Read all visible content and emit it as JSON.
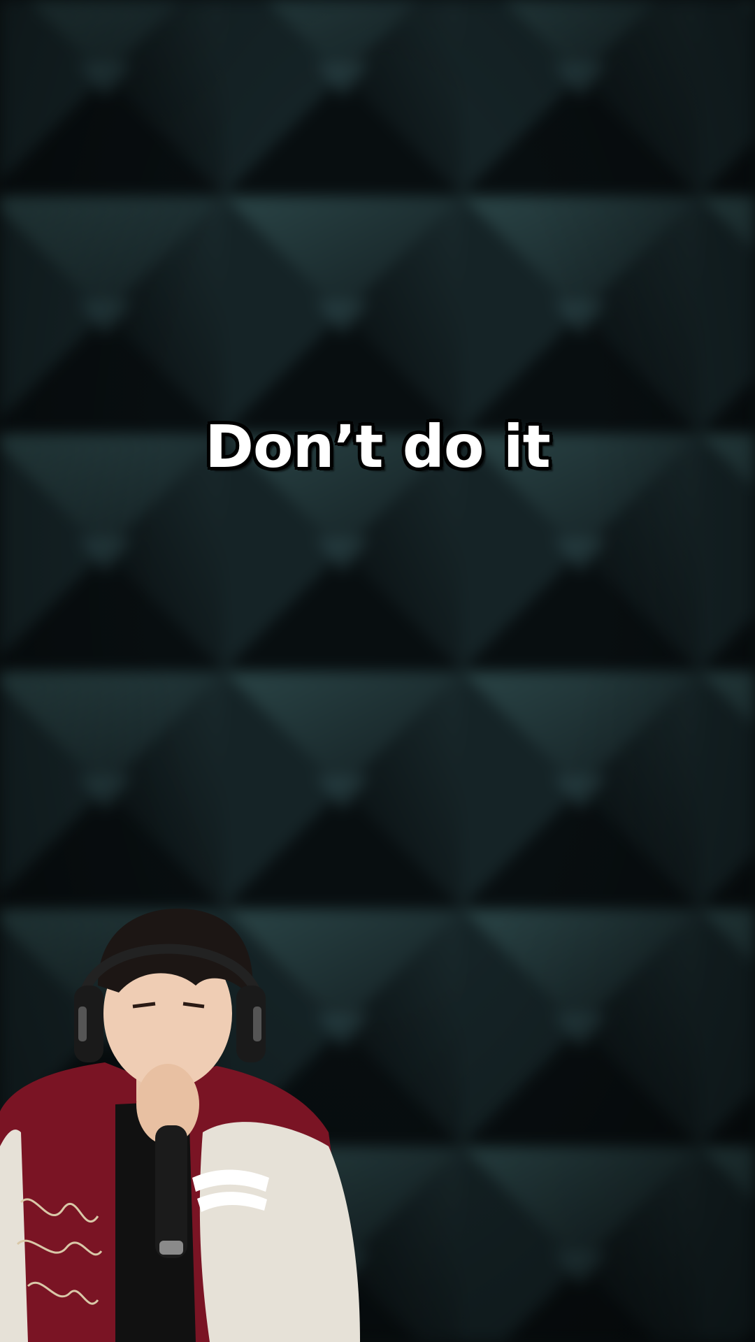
{
  "video": {
    "caption": "Don’t do it"
  },
  "colors": {
    "background": "#0b1214",
    "foam_highlight": "#2a4446",
    "caption_fill": "#ffffff",
    "caption_outline": "#000000",
    "jacket": "#7a1424",
    "sleeve": "#e8e4dc",
    "headphones": "#222222"
  }
}
